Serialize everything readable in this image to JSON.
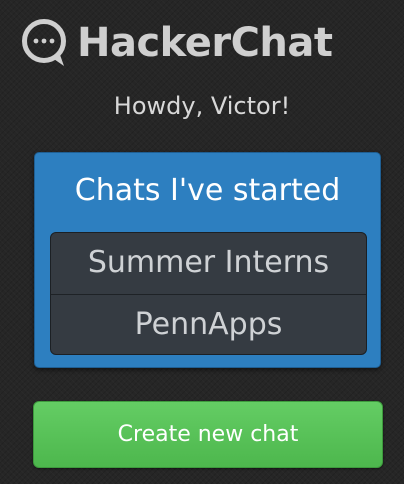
{
  "header": {
    "logo_icon": "chat-bubble-icon",
    "app_name": "HackerChat"
  },
  "greeting": "Howdy, Victor!",
  "chats_panel": {
    "title": "Chats I've started",
    "items": [
      {
        "label": "Summer Interns"
      },
      {
        "label": "PennApps"
      }
    ]
  },
  "actions": {
    "create_label": "Create new chat"
  },
  "colors": {
    "background": "#262626",
    "panel_blue": "#2d7fc0",
    "list_dark": "#353b42",
    "button_green": "#5bc45b",
    "logo_gray": "#cfcfcf"
  }
}
